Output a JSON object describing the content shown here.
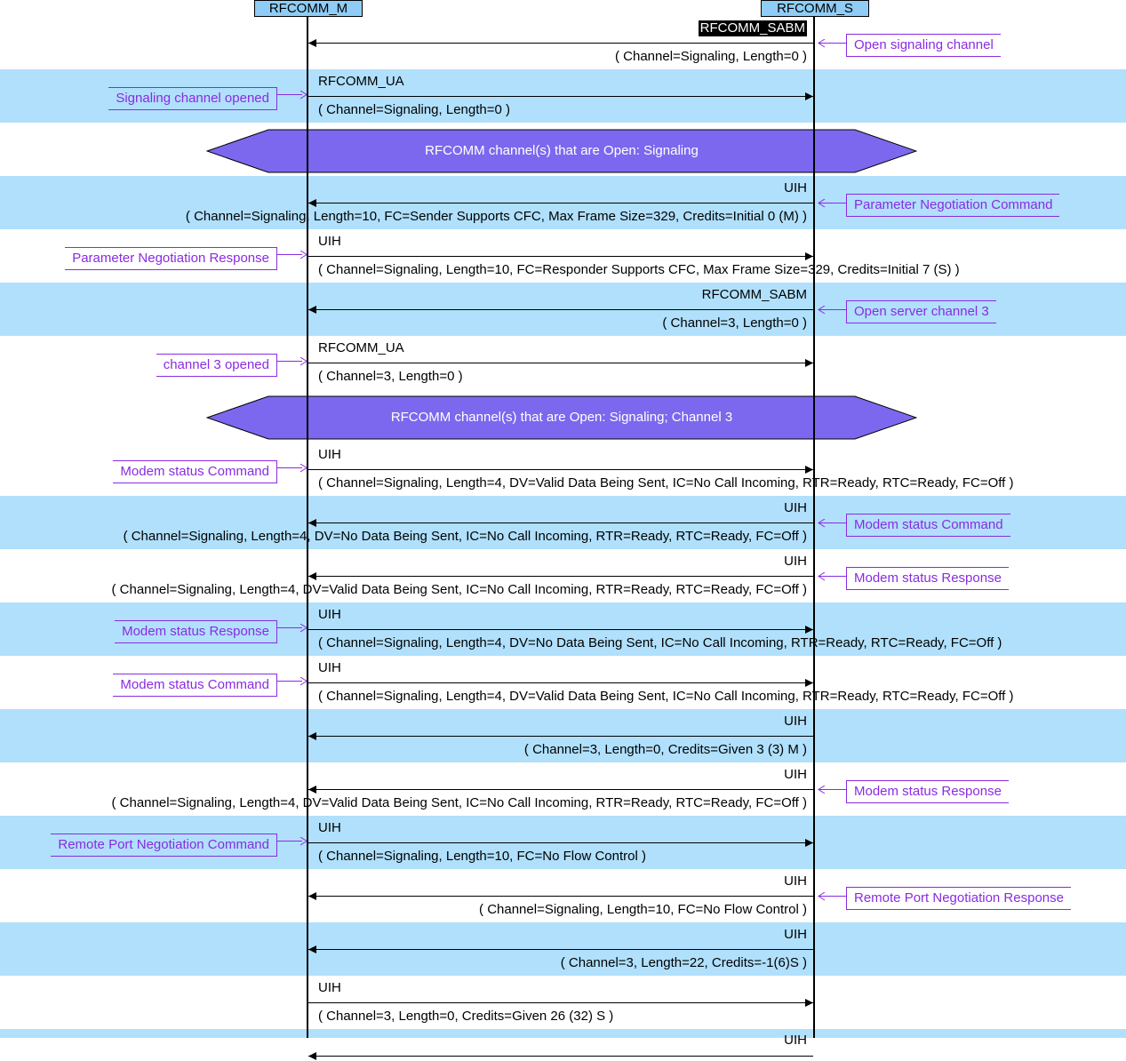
{
  "participants": {
    "master": "RFCOMM_M",
    "slave": "RFCOMM_S"
  },
  "colors": {
    "band_blue": "#b0e0fc",
    "participant_fill": "#8fcdf6",
    "state_fill": "#7b68ee",
    "note_color": "#8a2be2"
  },
  "rows": [
    {
      "type": "msg",
      "dir": "S2M",
      "band": "white",
      "name": "RFCOMM_SABM",
      "params": "( Channel=Signaling, Length=0 )",
      "note": "Open signaling channel",
      "highlight": true
    },
    {
      "type": "msg",
      "dir": "M2S",
      "band": "blue",
      "name": "RFCOMM_UA",
      "params": "( Channel=Signaling, Length=0 )",
      "note": "Signaling channel opened"
    },
    {
      "type": "state",
      "band": "white",
      "text": "RFCOMM channel(s) that are Open: Signaling"
    },
    {
      "type": "msg",
      "dir": "S2M",
      "band": "blue",
      "name": "UIH",
      "params": "( Channel=Signaling, Length=10, FC=Sender Supports CFC, Max Frame Size=329, Credits=Initial 0 (M) )",
      "note": "Parameter Negotiation Command"
    },
    {
      "type": "msg",
      "dir": "M2S",
      "band": "white",
      "name": "UIH",
      "params": "( Channel=Signaling, Length=10, FC=Responder Supports CFC, Max Frame Size=329, Credits=Initial 7 (S) )",
      "note": "Parameter Negotiation Response"
    },
    {
      "type": "msg",
      "dir": "S2M",
      "band": "blue",
      "name": "RFCOMM_SABM",
      "params": "( Channel=3, Length=0 )",
      "note": "Open server channel 3"
    },
    {
      "type": "msg",
      "dir": "M2S",
      "band": "white",
      "name": "RFCOMM_UA",
      "params": "( Channel=3, Length=0 )",
      "note": "channel 3 opened"
    },
    {
      "type": "state",
      "band": "white",
      "text": "RFCOMM channel(s) that are Open: Signaling; Channel 3"
    },
    {
      "type": "msg",
      "dir": "M2S",
      "band": "white",
      "name": "UIH",
      "params": "( Channel=Signaling, Length=4, DV=Valid Data Being Sent, IC=No Call Incoming, RTR=Ready, RTC=Ready, FC=Off )",
      "note": "Modem status Command"
    },
    {
      "type": "msg",
      "dir": "S2M",
      "band": "blue",
      "name": "UIH",
      "params": "( Channel=Signaling, Length=4, DV=No Data Being Sent, IC=No Call Incoming, RTR=Ready, RTC=Ready, FC=Off )",
      "note": "Modem status Command"
    },
    {
      "type": "msg",
      "dir": "S2M",
      "band": "white",
      "name": "UIH",
      "params": "( Channel=Signaling, Length=4, DV=Valid Data Being Sent, IC=No Call Incoming, RTR=Ready, RTC=Ready, FC=Off )",
      "note": "Modem status Response"
    },
    {
      "type": "msg",
      "dir": "M2S",
      "band": "blue",
      "name": "UIH",
      "params": "( Channel=Signaling, Length=4, DV=No Data Being Sent, IC=No Call Incoming, RTR=Ready, RTC=Ready, FC=Off )",
      "note": "Modem status Response"
    },
    {
      "type": "msg",
      "dir": "M2S",
      "band": "white",
      "name": "UIH",
      "params": "( Channel=Signaling, Length=4, DV=Valid Data Being Sent, IC=No Call Incoming, RTR=Ready, RTC=Ready, FC=Off )",
      "note": "Modem status Command"
    },
    {
      "type": "msg",
      "dir": "S2M",
      "band": "blue",
      "name": "UIH",
      "params": "( Channel=3, Length=0, Credits=Given 3 (3) M )",
      "note": ""
    },
    {
      "type": "msg",
      "dir": "S2M",
      "band": "white",
      "name": "UIH",
      "params": "( Channel=Signaling, Length=4, DV=Valid Data Being Sent, IC=No Call Incoming, RTR=Ready, RTC=Ready, FC=Off )",
      "note": "Modem status Response"
    },
    {
      "type": "msg",
      "dir": "M2S",
      "band": "blue",
      "name": "UIH",
      "params": "( Channel=Signaling, Length=10, FC=No Flow Control )",
      "note": "Remote Port Negotiation Command"
    },
    {
      "type": "msg",
      "dir": "S2M",
      "band": "white",
      "name": "UIH",
      "params": "( Channel=Signaling, Length=10, FC=No Flow Control )",
      "note": "Remote Port Negotiation Response"
    },
    {
      "type": "msg",
      "dir": "S2M",
      "band": "blue",
      "name": "UIH",
      "params": "( Channel=3, Length=22, Credits=-1(6)S )",
      "note": ""
    },
    {
      "type": "msg",
      "dir": "M2S",
      "band": "white",
      "name": "UIH",
      "params": "( Channel=3, Length=0, Credits=Given 26 (32) S )",
      "note": ""
    },
    {
      "type": "msg",
      "dir": "S2M",
      "band": "blue",
      "name": "UIH",
      "params": "",
      "note": "",
      "partial": true
    }
  ]
}
